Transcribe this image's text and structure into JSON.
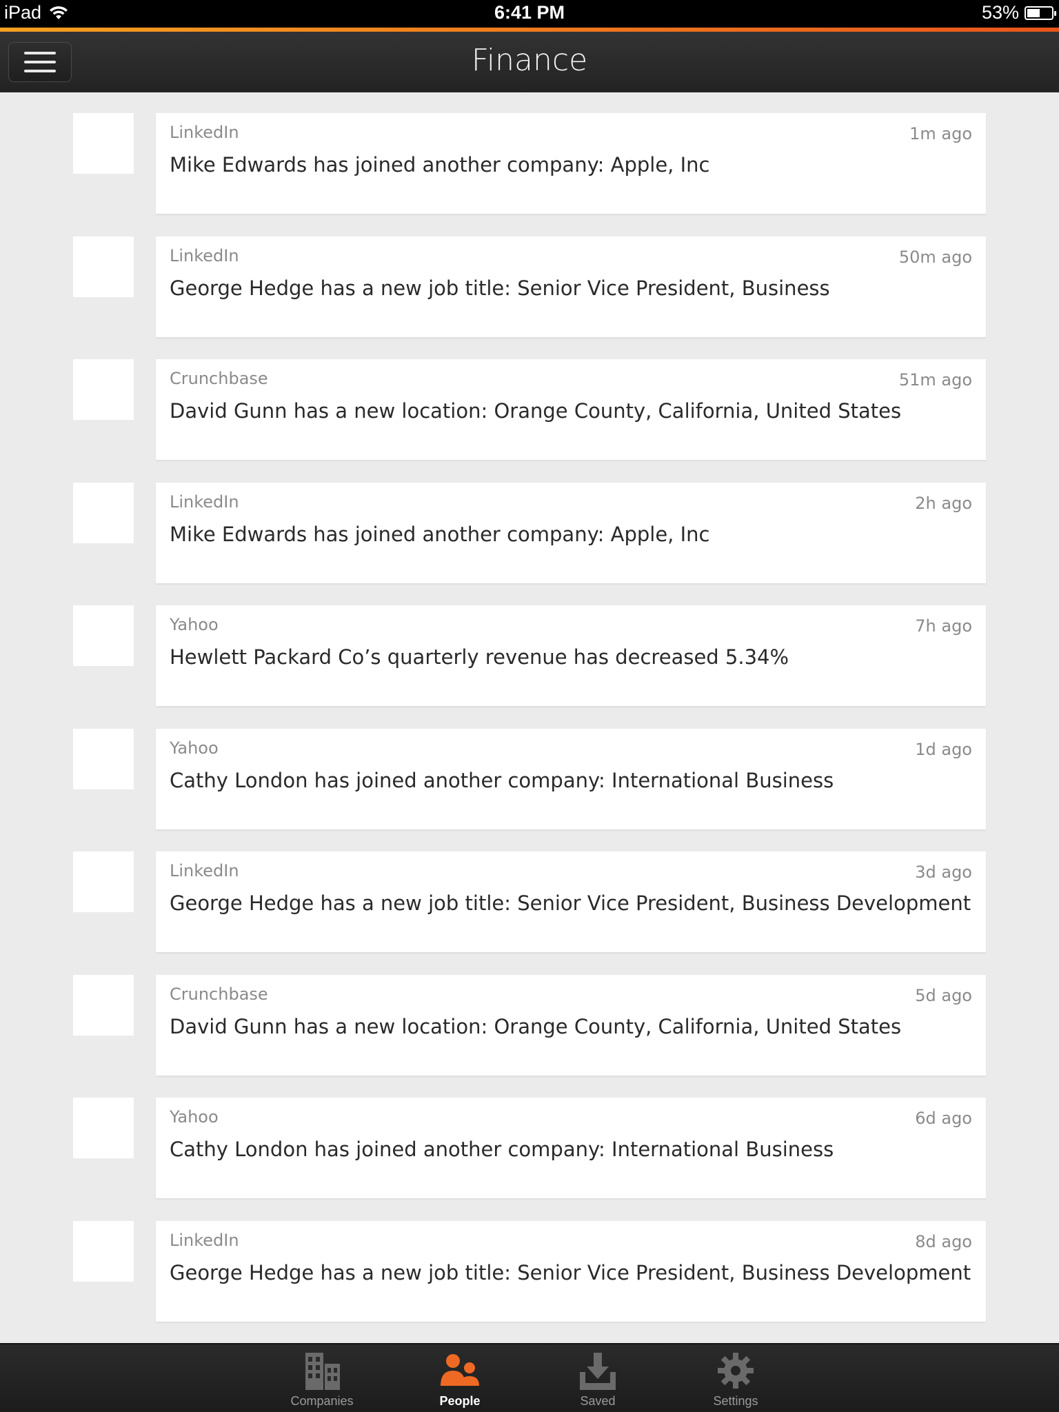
{
  "status_bar": {
    "device": "iPad",
    "time": "6:41 PM",
    "battery": "53%",
    "battery_level": 0.53
  },
  "header": {
    "title": "Finance"
  },
  "feed": [
    {
      "source": "LinkedIn",
      "message": "Mike Edwards has joined another company: Apple, Inc",
      "time": "1m ago"
    },
    {
      "source": "LinkedIn",
      "message": "George Hedge has a new job title: Senior Vice President, Business",
      "time": "50m ago"
    },
    {
      "source": "Crunchbase",
      "message": "David Gunn has a new location: Orange County, California, United States",
      "time": "51m ago"
    },
    {
      "source": "LinkedIn",
      "message": "Mike Edwards has joined another company: Apple, Inc",
      "time": "2h ago"
    },
    {
      "source": "Yahoo",
      "message": "Hewlett Packard Co’s quarterly revenue has decreased 5.34%",
      "time": "7h ago"
    },
    {
      "source": "Yahoo",
      "message": "Cathy London has joined another company: International Business",
      "time": "1d ago"
    },
    {
      "source": "LinkedIn",
      "message": "George Hedge has a new job title: Senior Vice President, Business Development",
      "time": "3d ago"
    },
    {
      "source": "Crunchbase",
      "message": "David Gunn has a new location: Orange County, California, United States",
      "time": "5d ago"
    },
    {
      "source": "Yahoo",
      "message": "Cathy London has joined another company: International Business",
      "time": "6d ago"
    },
    {
      "source": "LinkedIn",
      "message": "George Hedge has a new job title: Senior Vice President, Business Development",
      "time": "8d ago"
    }
  ],
  "tab_bar": {
    "tabs": [
      {
        "label": "Companies",
        "icon": "buildings-icon",
        "active": false
      },
      {
        "label": "People",
        "icon": "people-icon",
        "active": true
      },
      {
        "label": "Saved",
        "icon": "download-tray-icon",
        "active": false
      },
      {
        "label": "Settings",
        "icon": "gear-icon",
        "active": false
      }
    ],
    "active_color": "#ee6a24",
    "inactive_color": "#6a6a6a"
  },
  "colors": {
    "accent_start": "#f5a020",
    "accent_end": "#e8561c",
    "background": "#ebebeb"
  }
}
